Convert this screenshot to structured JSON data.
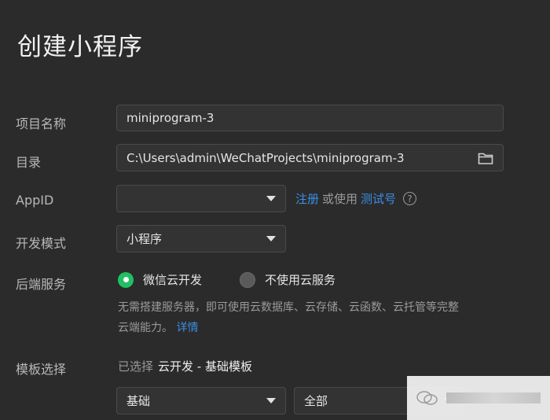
{
  "dialog": {
    "title": "创建小程序"
  },
  "form": {
    "project_name": {
      "label": "项目名称",
      "value": "miniprogram-3"
    },
    "directory": {
      "label": "目录",
      "value": "C:\\Users\\admin\\WeChatProjects\\miniprogram-3",
      "icon": "folder-icon"
    },
    "appid": {
      "label": "AppID",
      "value": "",
      "register_link": "注册",
      "or_use": "或使用",
      "test_link": "测试号",
      "help_icon": "question-circle-icon"
    },
    "dev_mode": {
      "label": "开发模式",
      "value": "小程序"
    },
    "backend": {
      "label": "后端服务",
      "options": [
        {
          "label": "微信云开发",
          "selected": true
        },
        {
          "label": "不使用云服务",
          "selected": false
        }
      ],
      "description_line1": "无需搭建服务器，即可使用云数据库、云存储、云函数、云托管等完整",
      "description_line2": "云端能力。",
      "details_link": "详情"
    },
    "template": {
      "label": "模板选择",
      "selected_prefix": "已选择",
      "selected_value": "云开发 - 基础模板",
      "category_select": "基础",
      "filter_select": "全部"
    }
  },
  "colors": {
    "accent_green": "#21c063",
    "link_blue": "#3a8ee6",
    "background": "#2b2b2b"
  }
}
